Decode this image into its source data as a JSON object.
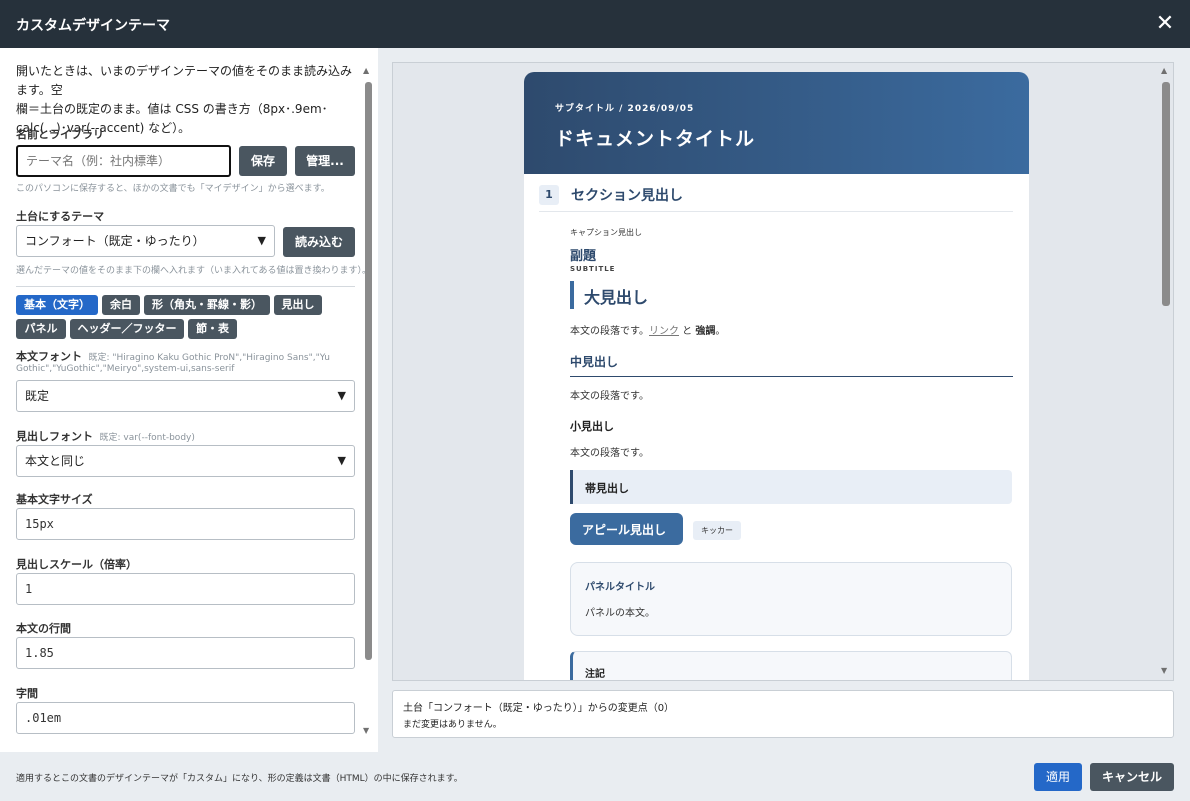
{
  "dialog": {
    "title": "カスタムデザインテーマ",
    "close_symbol": "✕"
  },
  "left": {
    "intro_line1": "開いたときは、いまのデザインテーマの値をそのまま読み込みます。空",
    "intro_line2": "欄＝土台の既定のまま。値は CSS の書き方（8px･.9em･",
    "intro_line3": "calc(...)･var(--accent) など）。",
    "name_section": {
      "label": "名前とライブラリ",
      "placeholder": "テーマ名（例：社内標準）",
      "save_label": "保存",
      "manage_label": "管理...",
      "hint": "このパソコンに保存すると、ほかの文書でも「マイデザイン」から選べます。"
    },
    "base_section": {
      "label": "土台にするテーマ",
      "selected": "コンフォート（既定・ゆったり）",
      "load_label": "読み込む",
      "hint": "選んだテーマの値をそのまま下の欄へ入れます（いま入れてある値は置き換わります）。"
    },
    "tabs": [
      "基本（文字）",
      "余白",
      "形（角丸・罫線・影）",
      "見出し",
      "パネル",
      "ヘッダー／フッター",
      "節・表"
    ],
    "fields": {
      "body_font": {
        "label": "本文フォント",
        "default_line1": "既定: \"Hiragino Kaku Gothic ProN\",\"Hiragino Sans\",\"Yu",
        "default_line2": "Gothic\",\"YuGothic\",\"Meiryo\",system-ui,sans-serif",
        "value": "既定"
      },
      "heading_font": {
        "label": "見出しフォント",
        "default": "既定: var(--font-body)",
        "value": "本文と同じ"
      },
      "base_size": {
        "label": "基本文字サイズ",
        "value": "15px"
      },
      "heading_scale": {
        "label": "見出しスケール（倍率）",
        "value": "1"
      },
      "line_height": {
        "label": "本文の行間",
        "value": "1.85"
      },
      "letter_spacing": {
        "label": "字間",
        "value": ".01em"
      }
    }
  },
  "preview": {
    "subtitle_date": "サブタイトル / 2026/09/05",
    "doc_title": "ドキュメントタイトル",
    "section_number": "1",
    "section_heading": "セクション見出し",
    "caption_heading": "キャプション見出し",
    "sub_heading": "副題",
    "sub_heading_en": "SUBTITLE",
    "large_heading": "大見出し",
    "para_prefix": "本文の段落です。",
    "link_text": "リンク",
    "and_text": " と ",
    "emphasis": "強調",
    "period": "。",
    "mid_heading": "中見出し",
    "para": "本文の段落です。",
    "small_heading": "小見出し",
    "band_heading": "帯見出し",
    "appeal_heading": "アピール見出し",
    "kicker": "キッカー",
    "panel_title": "パネルタイトル",
    "panel_body": "パネルの本文。",
    "note_title": "注記"
  },
  "changes": {
    "summary": "土台「コンフォート（既定・ゆったり）」からの変更点（0）",
    "empty": "まだ変更はありません。"
  },
  "footer": {
    "note": "適用するとこの文書のデザインテーマが「カスタム」になり、形の定義は文書（HTML）の中に保存されます。",
    "apply_label": "適用",
    "cancel_label": "キャンセル"
  },
  "colors": {
    "titlebar": "#26313b",
    "accent": "#2468c8",
    "doc_header": "#2e4a6d",
    "button_dark": "#4a5660"
  }
}
